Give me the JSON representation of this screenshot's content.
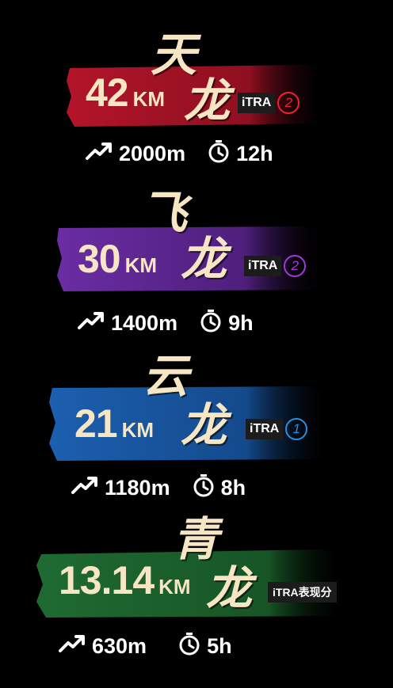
{
  "races": [
    {
      "distance": "42",
      "unit": "KM",
      "name_char1": "天",
      "name_char2": "龙",
      "itra_label": "iTRA",
      "itra_points": "2",
      "elevation": "2000m",
      "time": "12h",
      "color": "#b3152a",
      "accent": "#e3243a"
    },
    {
      "distance": "30",
      "unit": "KM",
      "name_char1": "飞",
      "name_char2": "龙",
      "itra_label": "iTRA",
      "itra_points": "2",
      "elevation": "1400m",
      "time": "9h",
      "color": "#6a2da3",
      "accent": "#a23ad8"
    },
    {
      "distance": "21",
      "unit": "KM",
      "name_char1": "云",
      "name_char2": "龙",
      "itra_label": "iTRA",
      "itra_points": "1",
      "elevation": "1180m",
      "time": "8h",
      "color": "#1c5fb0",
      "accent": "#2a8de0"
    },
    {
      "distance": "13.14",
      "unit": "KM",
      "name_char1": "青",
      "name_char2": "龙",
      "itra_label": "iTRA表现分",
      "itra_points": "",
      "elevation": "630m",
      "time": "5h",
      "color": "#1f6b33",
      "accent": "#2fa24a"
    }
  ],
  "icons": {
    "elevation": "trend-up-icon",
    "time": "stopwatch-icon"
  }
}
